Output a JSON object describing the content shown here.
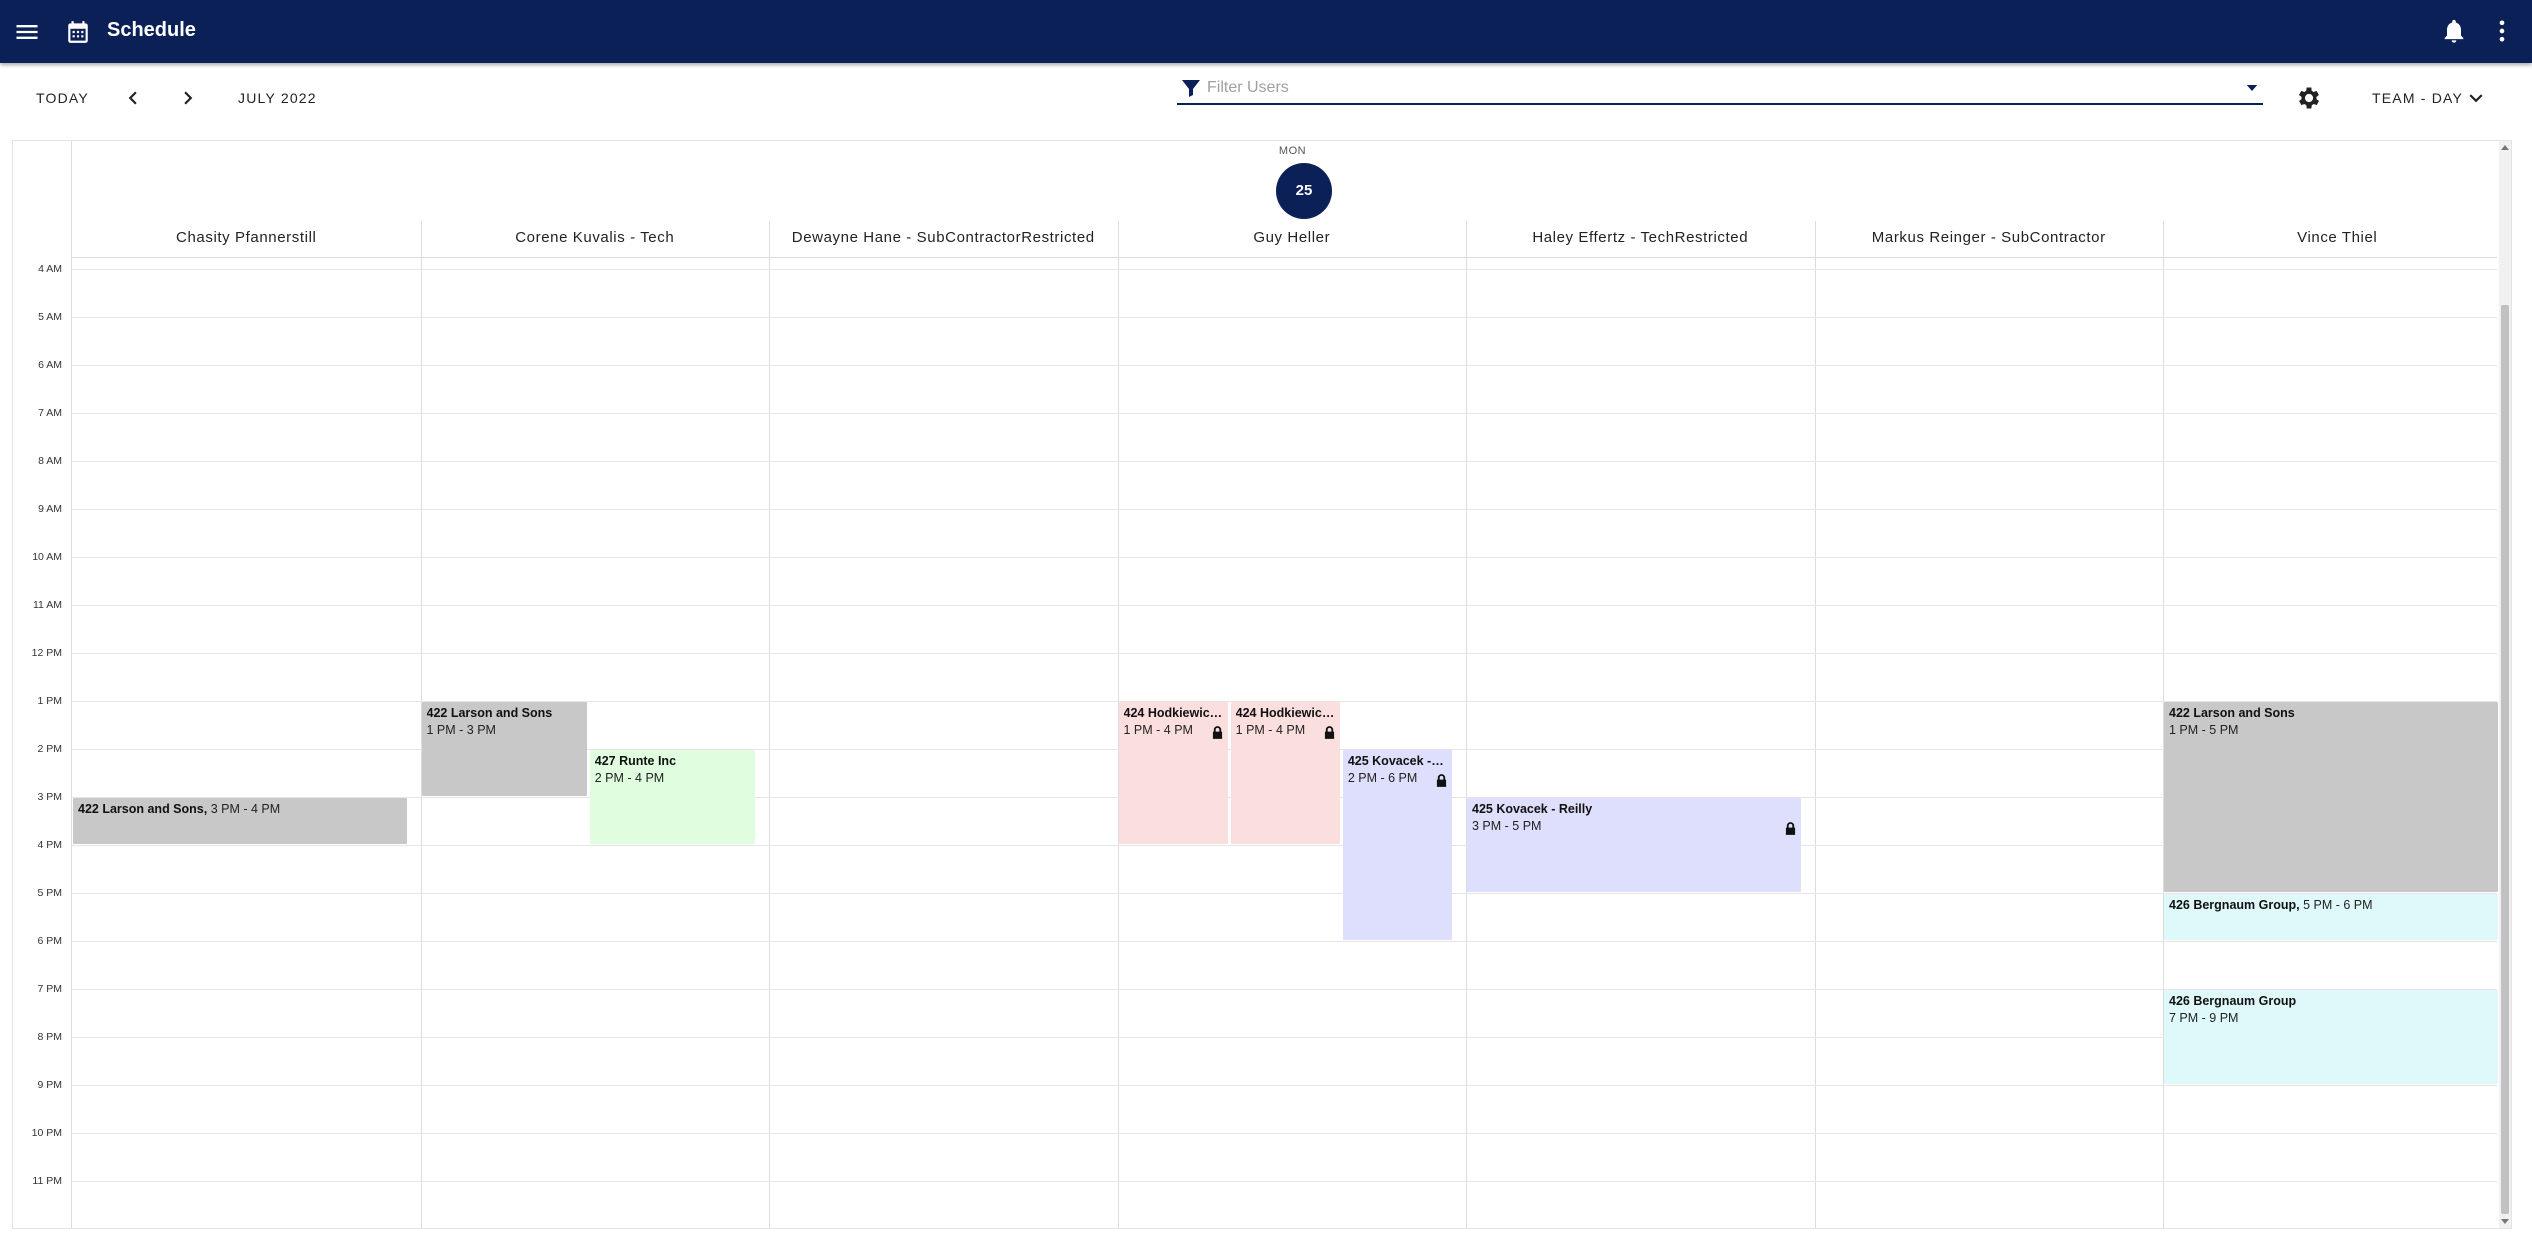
{
  "appbar": {
    "title": "Schedule",
    "icons": [
      "menu-icon",
      "calendar-icon",
      "bell-icon",
      "more-vert-icon"
    ],
    "color": "#0b2057"
  },
  "toolbar": {
    "today_label": "TODAY",
    "month_label": "JULY 2022",
    "filter_placeholder": "Filter Users",
    "view_label": "TEAM - DAY"
  },
  "day": {
    "dow": "MON",
    "date": "25"
  },
  "columns": [
    "Chasity Pfannerstill",
    "Corene Kuvalis - Tech",
    "Dewayne Hane - SubContractorRestricted",
    "Guy Heller",
    "Haley Effertz - TechRestricted",
    "Markus Reinger - SubContractor",
    "Vince Thiel"
  ],
  "time_labels": [
    "4 AM",
    "5 AM",
    "6 AM",
    "7 AM",
    "8 AM",
    "9 AM",
    "10 AM",
    "11 AM",
    "12 PM",
    "1 PM",
    "2 PM",
    "3 PM",
    "4 PM",
    "5 PM",
    "6 PM",
    "7 PM",
    "8 PM",
    "9 PM",
    "10 PM",
    "11 PM"
  ],
  "events": [
    {
      "title": "422 Larson and Sons",
      "time": "3 PM - 4 PM",
      "start": 15,
      "end": 16,
      "col": 0,
      "lane": 0,
      "lanes": 1,
      "color": "grey",
      "inline": true,
      "locked": false
    },
    {
      "title": "422 Larson and Sons",
      "time": "1 PM - 3 PM",
      "start": 13,
      "end": 15,
      "col": 1,
      "lane": 0,
      "lanes": 2,
      "color": "grey",
      "inline": false,
      "locked": false
    },
    {
      "title": "427 Runte Inc",
      "time": "2 PM - 4 PM",
      "start": 14,
      "end": 16,
      "col": 1,
      "lane": 1,
      "lanes": 2,
      "color": "green",
      "inline": false,
      "locked": false
    },
    {
      "title": "424 Hodkiewicz - ...",
      "time": "1 PM - 4 PM",
      "start": 13,
      "end": 16,
      "col": 3,
      "lane": 0,
      "lanes": 3,
      "color": "pink",
      "inline": false,
      "locked": true
    },
    {
      "title": "424 Hodkiewicz - ...",
      "time": "1 PM - 4 PM",
      "start": 13,
      "end": 16,
      "col": 3,
      "lane": 1,
      "lanes": 3,
      "color": "pink",
      "inline": false,
      "locked": true
    },
    {
      "title": "425 Kovacek - Re...",
      "time": "2 PM - 6 PM",
      "start": 14,
      "end": 18,
      "col": 3,
      "lane": 2,
      "lanes": 3,
      "color": "lav",
      "inline": false,
      "locked": true
    },
    {
      "title": "425 Kovacek - Reilly",
      "time": "3 PM - 5 PM",
      "start": 15,
      "end": 17,
      "col": 4,
      "lane": 0,
      "lanes": 1,
      "color": "lav",
      "inline": false,
      "locked": true
    },
    {
      "title": "422 Larson and Sons",
      "time": "1 PM - 5 PM",
      "start": 13,
      "end": 17,
      "col": 6,
      "lane": 0,
      "lanes": 1,
      "color": "grey",
      "inline": false,
      "locked": false
    },
    {
      "title": "426 Bergnaum Group",
      "time": "5 PM - 6 PM",
      "start": 17,
      "end": 18,
      "col": 6,
      "lane": 0,
      "lanes": 1,
      "color": "cyan",
      "inline": true,
      "locked": false
    },
    {
      "title": "426 Bergnaum Group",
      "time": "7 PM - 9 PM",
      "start": 19,
      "end": 21,
      "col": 6,
      "lane": 0,
      "lanes": 1,
      "color": "cyan",
      "inline": false,
      "locked": false
    }
  ]
}
